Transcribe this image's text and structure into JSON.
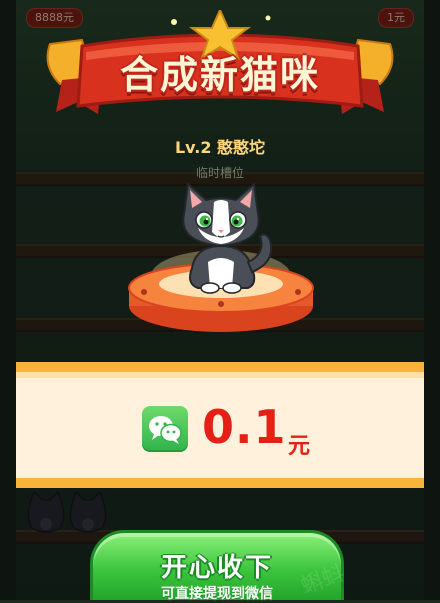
{
  "background": {
    "top_left_badge": "8888元",
    "top_right_badge": "1元"
  },
  "banner": {
    "title": "合成新猫咪"
  },
  "cat": {
    "level_name": "Lv.2 憨憨坨",
    "slot_label": "临时槽位"
  },
  "reward": {
    "icon": "wechat-icon",
    "amount": "0.1",
    "unit": "元"
  },
  "claim": {
    "label": "开心收下",
    "sublabel": "可直接提现到微信"
  },
  "watermark": "蝌蚪",
  "colors": {
    "reward_red": "#e52014",
    "button_green": "#3cc53d",
    "band_orange": "#f7b33a",
    "banner_red": "#d8321f",
    "banner_gold": "#f9c031"
  }
}
